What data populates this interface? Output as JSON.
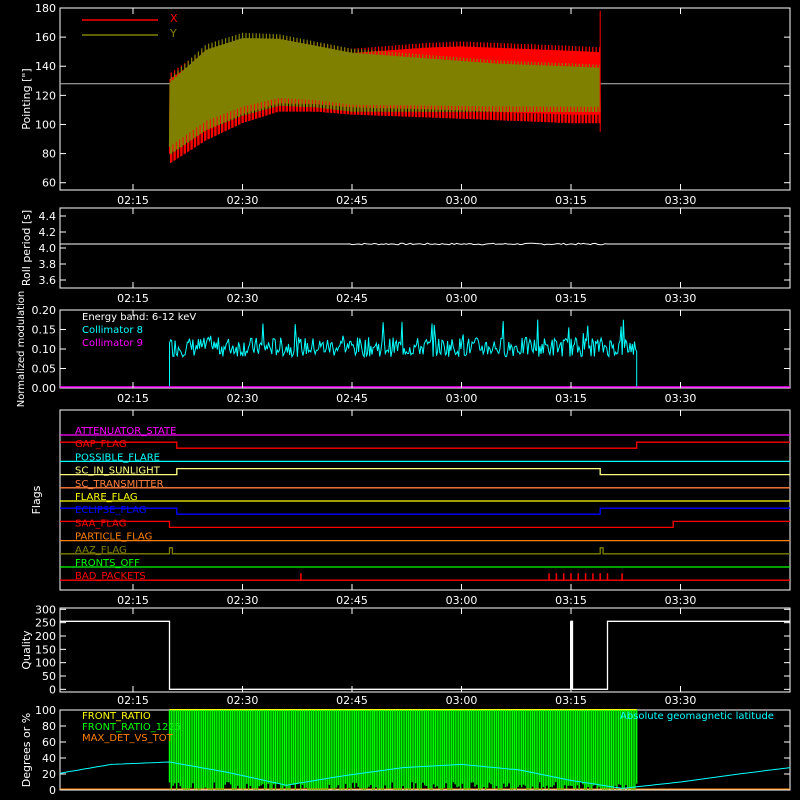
{
  "colors": {
    "background": "#000000",
    "axis": "#ffffff",
    "x_series": "#ff0000",
    "y_series": "#808000",
    "collimator8": "#00ffff",
    "collimator9": "#ff00ff",
    "quality": "#ffffff",
    "front_ratio": "#ffff00",
    "front_ratio_1225": "#00ff00",
    "max_det": "#ff8000",
    "geomag": "#00ffff"
  },
  "time_ticks": [
    "02:15",
    "02:30",
    "02:45",
    "03:00",
    "03:15",
    "03:30"
  ],
  "chart_data": [
    {
      "id": "pointing",
      "type": "line",
      "ylabel": "Pointing [\"]",
      "ylim": [
        55,
        180
      ],
      "yticks": [
        "60",
        "80",
        "100",
        "120",
        "140",
        "160",
        "180"
      ],
      "legend": [
        "X",
        "Y"
      ],
      "reference_value": 128,
      "time_range": [
        "02:05",
        "03:45"
      ],
      "data_span": [
        "02:20",
        "03:19"
      ],
      "series": [
        {
          "name": "X",
          "x": [
            "02:20",
            "02:25",
            "02:30",
            "02:35",
            "02:40",
            "02:45",
            "02:50",
            "02:55",
            "03:00",
            "03:05",
            "03:10",
            "03:15",
            "03:19"
          ],
          "upper": [
            135,
            152,
            158,
            160,
            156,
            152,
            154,
            156,
            157,
            156,
            155,
            154,
            153
          ],
          "lower": [
            72,
            88,
            100,
            108,
            108,
            106,
            105,
            104,
            103,
            102,
            101,
            100,
            100
          ]
        },
        {
          "name": "Y",
          "x": [
            "02:20",
            "02:25",
            "02:30",
            "02:35",
            "02:40",
            "02:45",
            "02:50",
            "02:55",
            "03:00",
            "03:05",
            "03:10",
            "03:15",
            "03:19"
          ],
          "upper": [
            132,
            155,
            163,
            162,
            157,
            152,
            150,
            148,
            146,
            144,
            143,
            142,
            141
          ],
          "lower": [
            78,
            95,
            105,
            112,
            111,
            108,
            108,
            108,
            108,
            108,
            108,
            108,
            108
          ]
        }
      ]
    },
    {
      "id": "roll",
      "type": "line",
      "ylabel": "Roll period [s]",
      "ylim": [
        3.5,
        4.5
      ],
      "yticks": [
        "3.6",
        "3.8",
        "4.0",
        "4.2",
        "4.4"
      ],
      "series": [
        {
          "name": "",
          "x": [
            "02:05",
            "03:45"
          ],
          "y": [
            4.05,
            4.05
          ]
        }
      ]
    },
    {
      "id": "modulation",
      "type": "line",
      "ylabel": "Normalized modulation",
      "ylim": [
        0,
        0.2
      ],
      "yticks": [
        "0.00",
        "0.05",
        "0.10",
        "0.15",
        "0.20"
      ],
      "annotation": "Energy band: 6-12 keV",
      "legend": [
        "Collimator 8",
        "Collimator 9"
      ],
      "series": [
        {
          "name": "Collimator 8",
          "x_start": "02:20",
          "x_end": "03:24",
          "mean": 0.105,
          "spread": 0.025
        },
        {
          "name": "Collimator 9",
          "x": [
            "02:05",
            "03:45"
          ],
          "y": [
            0,
            0
          ]
        }
      ]
    },
    {
      "id": "flags",
      "type": "line",
      "ylabel": "Flags",
      "flags": [
        {
          "name": "ATTENUATOR_STATE",
          "color": "#ff00ff",
          "high": []
        },
        {
          "name": "GAP_FLAG",
          "color": "#ff0000",
          "high": [
            [
              "02:05",
              "02:21"
            ],
            [
              "03:24",
              "03:45"
            ]
          ]
        },
        {
          "name": "POSSIBLE_FLARE",
          "color": "#00ffff",
          "high": []
        },
        {
          "name": "SC_IN_SUNLIGHT",
          "color": "#ffff80",
          "high": [
            [
              "02:21",
              "03:19"
            ]
          ]
        },
        {
          "name": "SC_TRANSMITTER",
          "color": "#ff8040",
          "high": []
        },
        {
          "name": "FLARE_FLAG",
          "color": "#ffff00",
          "high": []
        },
        {
          "name": "ECLIPSE_FLAG",
          "color": "#0000ff",
          "high": [
            [
              "02:05",
              "02:21"
            ],
            [
              "03:19",
              "03:45"
            ]
          ]
        },
        {
          "name": "SAA_FLAG",
          "color": "#ff0000",
          "high": [
            [
              "02:05",
              "02:20"
            ],
            [
              "03:29",
              "03:45"
            ]
          ]
        },
        {
          "name": "PARTICLE_FLAG",
          "color": "#ff8000",
          "high": []
        },
        {
          "name": "AAZ_FLAG",
          "color": "#808000",
          "high": [
            [
              "02:20",
              "02:20.4"
            ],
            [
              "03:19",
              "03:19.4"
            ]
          ]
        },
        {
          "name": "FRONTS_OFF",
          "color": "#00ff00",
          "high": []
        },
        {
          "name": "BAD_PACKETS",
          "color": "#ff0000",
          "high": [],
          "spikes": [
            "02:38",
            "03:12",
            "03:13",
            "03:14",
            "03:15",
            "03:16",
            "03:17",
            "03:18",
            "03:19",
            "03:20",
            "03:22"
          ]
        }
      ]
    },
    {
      "id": "quality",
      "type": "line",
      "ylabel": "Quality",
      "ylim": [
        -10,
        305
      ],
      "yticks": [
        "0",
        "50",
        "100",
        "150",
        "200",
        "250",
        "300"
      ],
      "segments": [
        {
          "x": [
            "02:05",
            "02:20"
          ],
          "y": 255
        },
        {
          "x": [
            "02:20",
            "03:15"
          ],
          "y": 0
        },
        {
          "x": [
            "03:15",
            "03:15.2"
          ],
          "y": 255
        },
        {
          "x": [
            "03:15.2",
            "03:20"
          ],
          "y": 0
        },
        {
          "x": [
            "03:20",
            "03:45"
          ],
          "y": 255
        }
      ]
    },
    {
      "id": "ratios",
      "type": "line",
      "ylabel": "Degrees or %",
      "ylim": [
        0,
        100
      ],
      "yticks": [
        "0",
        "20",
        "40",
        "60",
        "80",
        "100"
      ],
      "legend": [
        "FRONT_RATIO",
        "FRONT_RATIO_1225",
        "MAX_DET_VS_TOT"
      ],
      "right_label": "Absolute geomagnetic latitude",
      "front_ratio_span": [
        "02:20",
        "03:24"
      ],
      "geomag_latitude": {
        "x": [
          "02:05",
          "02:12",
          "02:20",
          "02:28",
          "02:36",
          "02:44",
          "02:52",
          "03:00",
          "03:08",
          "03:15",
          "03:22",
          "03:30",
          "03:38",
          "03:45"
        ],
        "y": [
          21,
          32,
          35,
          22,
          6,
          18,
          28,
          32,
          25,
          12,
          2,
          10,
          20,
          28
        ]
      }
    }
  ]
}
